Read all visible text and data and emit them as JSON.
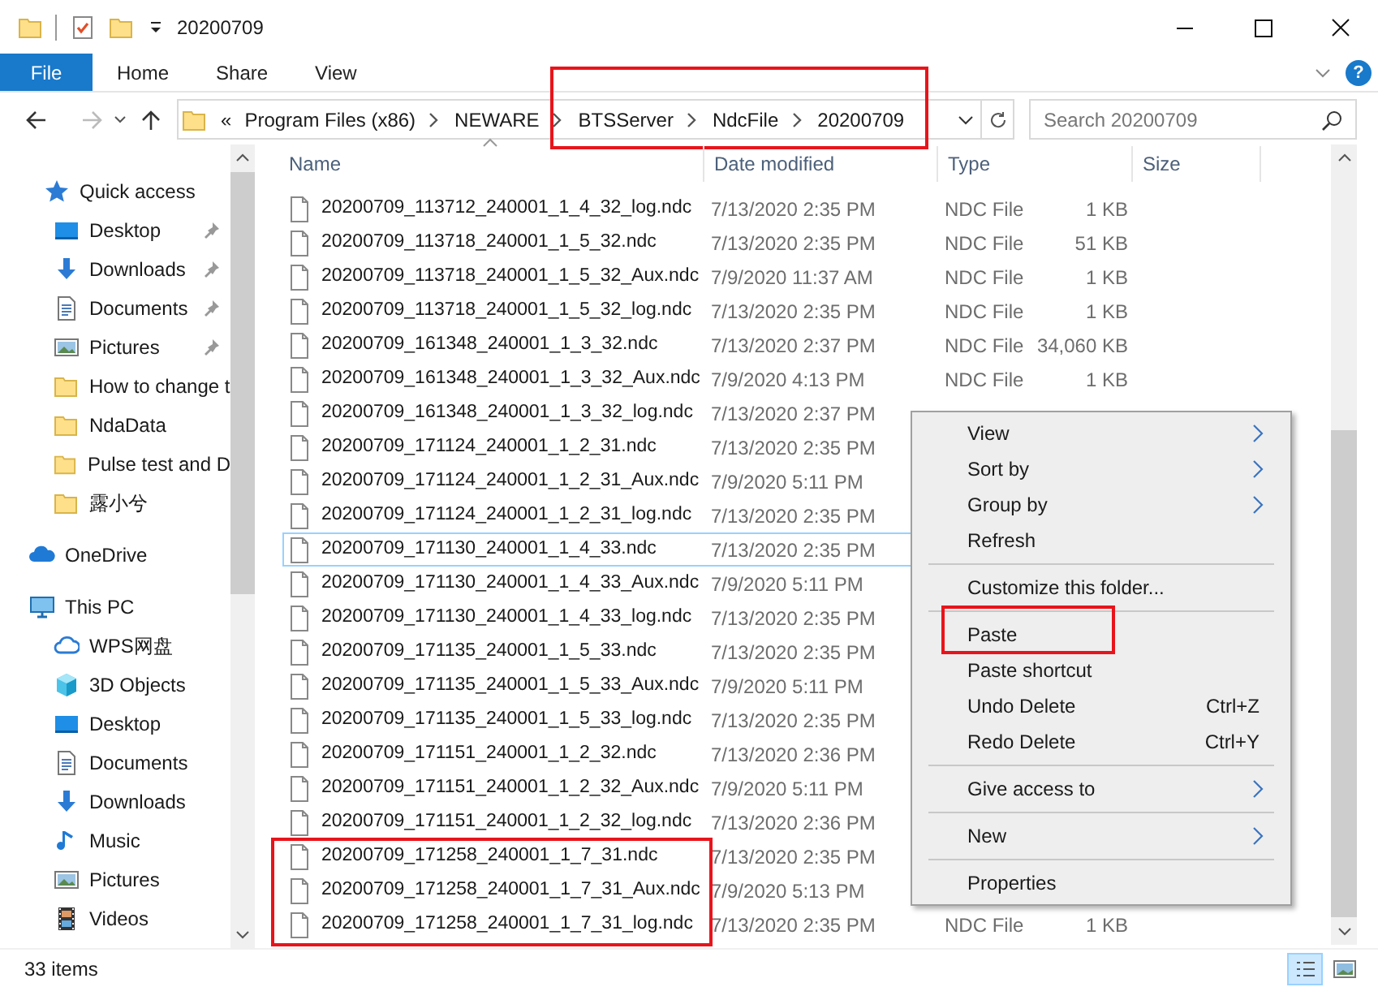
{
  "window": {
    "title": "20200709"
  },
  "ribbon": {
    "tabs": [
      {
        "label": "File",
        "selected": true
      },
      {
        "label": "Home",
        "selected": false
      },
      {
        "label": "Share",
        "selected": false
      },
      {
        "label": "View",
        "selected": false
      }
    ],
    "help": "?"
  },
  "address": {
    "overflow": "«",
    "crumbs": [
      {
        "label": "Program Files (x86)",
        "highlighted": false
      },
      {
        "label": "NEWARE",
        "highlighted": false
      },
      {
        "label": "BTSServer",
        "highlighted": true
      },
      {
        "label": "NdcFile",
        "highlighted": true
      },
      {
        "label": "20200709",
        "highlighted": true
      }
    ]
  },
  "search": {
    "placeholder": "Search 20200709"
  },
  "nav": [
    {
      "label": "Quick access",
      "kind": "star",
      "children": [
        {
          "label": "Desktop",
          "kind": "desktop",
          "pinned": true
        },
        {
          "label": "Downloads",
          "kind": "download",
          "pinned": true
        },
        {
          "label": "Documents",
          "kind": "document",
          "pinned": true
        },
        {
          "label": "Pictures",
          "kind": "picture",
          "pinned": true
        },
        {
          "label": "How to change t",
          "kind": "folder",
          "pinned": false
        },
        {
          "label": "NdaData",
          "kind": "folder",
          "pinned": false
        },
        {
          "label": "Pulse test and D",
          "kind": "folder",
          "pinned": false
        },
        {
          "label": "露小兮",
          "kind": "folder",
          "pinned": false
        }
      ]
    },
    {
      "label": "OneDrive",
      "kind": "onedrive"
    },
    {
      "label": "This PC",
      "kind": "pc",
      "children": [
        {
          "label": "WPS网盘",
          "kind": "cloud",
          "pinned": false
        },
        {
          "label": "3D Objects",
          "kind": "cube",
          "pinned": false
        },
        {
          "label": "Desktop",
          "kind": "desktop",
          "pinned": false
        },
        {
          "label": "Documents",
          "kind": "document",
          "pinned": false
        },
        {
          "label": "Downloads",
          "kind": "download",
          "pinned": false
        },
        {
          "label": "Music",
          "kind": "music",
          "pinned": false
        },
        {
          "label": "Pictures",
          "kind": "picture",
          "pinned": false
        },
        {
          "label": "Videos",
          "kind": "video",
          "pinned": false
        }
      ]
    }
  ],
  "table": {
    "columns": [
      "Name",
      "Date modified",
      "Type",
      "Size"
    ],
    "rows": [
      {
        "name": "20200709_113712_240001_1_4_32_log.ndc",
        "date": "7/13/2020 2:35 PM",
        "type": "NDC File",
        "size": "1 KB",
        "focused": false,
        "highlighted": false
      },
      {
        "name": "20200709_113718_240001_1_5_32.ndc",
        "date": "7/13/2020 2:35 PM",
        "type": "NDC File",
        "size": "51 KB",
        "focused": false,
        "highlighted": false
      },
      {
        "name": "20200709_113718_240001_1_5_32_Aux.ndc",
        "date": "7/9/2020 11:37 AM",
        "type": "NDC File",
        "size": "1 KB",
        "focused": false,
        "highlighted": false
      },
      {
        "name": "20200709_113718_240001_1_5_32_log.ndc",
        "date": "7/13/2020 2:35 PM",
        "type": "NDC File",
        "size": "1 KB",
        "focused": false,
        "highlighted": false
      },
      {
        "name": "20200709_161348_240001_1_3_32.ndc",
        "date": "7/13/2020 2:37 PM",
        "type": "NDC File",
        "size": "34,060 KB",
        "focused": false,
        "highlighted": false
      },
      {
        "name": "20200709_161348_240001_1_3_32_Aux.ndc",
        "date": "7/9/2020 4:13 PM",
        "type": "NDC File",
        "size": "1 KB",
        "focused": false,
        "highlighted": false
      },
      {
        "name": "20200709_161348_240001_1_3_32_log.ndc",
        "date": "7/13/2020 2:37 PM",
        "focused": false,
        "highlighted": false
      },
      {
        "name": "20200709_171124_240001_1_2_31.ndc",
        "date": "7/13/2020 2:35 PM",
        "focused": false,
        "highlighted": false
      },
      {
        "name": "20200709_171124_240001_1_2_31_Aux.ndc",
        "date": "7/9/2020 5:11 PM",
        "focused": false,
        "highlighted": false
      },
      {
        "name": "20200709_171124_240001_1_2_31_log.ndc",
        "date": "7/13/2020 2:35 PM",
        "focused": false,
        "highlighted": false
      },
      {
        "name": "20200709_171130_240001_1_4_33.ndc",
        "date": "7/13/2020 2:35 PM",
        "focused": true,
        "highlighted": false
      },
      {
        "name": "20200709_171130_240001_1_4_33_Aux.ndc",
        "date": "7/9/2020 5:11 PM",
        "focused": false,
        "highlighted": false
      },
      {
        "name": "20200709_171130_240001_1_4_33_log.ndc",
        "date": "7/13/2020 2:35 PM",
        "focused": false,
        "highlighted": false
      },
      {
        "name": "20200709_171135_240001_1_5_33.ndc",
        "date": "7/13/2020 2:35 PM",
        "focused": false,
        "highlighted": false
      },
      {
        "name": "20200709_171135_240001_1_5_33_Aux.ndc",
        "date": "7/9/2020 5:11 PM",
        "focused": false,
        "highlighted": false
      },
      {
        "name": "20200709_171135_240001_1_5_33_log.ndc",
        "date": "7/13/2020 2:35 PM",
        "focused": false,
        "highlighted": false
      },
      {
        "name": "20200709_171151_240001_1_2_32.ndc",
        "date": "7/13/2020 2:36 PM",
        "focused": false,
        "highlighted": false
      },
      {
        "name": "20200709_171151_240001_1_2_32_Aux.ndc",
        "date": "7/9/2020 5:11 PM",
        "focused": false,
        "highlighted": false
      },
      {
        "name": "20200709_171151_240001_1_2_32_log.ndc",
        "date": "7/13/2020 2:36 PM",
        "focused": false,
        "highlighted": false
      },
      {
        "name": "20200709_171258_240001_1_7_31.ndc",
        "date": "7/13/2020 2:35 PM",
        "focused": false,
        "highlighted": true
      },
      {
        "name": "20200709_171258_240001_1_7_31_Aux.ndc",
        "date": "7/9/2020 5:13 PM",
        "focused": false,
        "highlighted": true
      },
      {
        "name": "20200709_171258_240001_1_7_31_log.ndc",
        "date": "7/13/2020 2:35 PM",
        "type": "NDC File",
        "size": "1 KB",
        "focused": false,
        "highlighted": true
      }
    ]
  },
  "context_menu": {
    "items": [
      {
        "kind": "item",
        "label": "View",
        "submenu": true,
        "highlighted": false
      },
      {
        "kind": "item",
        "label": "Sort by",
        "submenu": true,
        "highlighted": false
      },
      {
        "kind": "item",
        "label": "Group by",
        "submenu": true,
        "highlighted": false
      },
      {
        "kind": "item",
        "label": "Refresh",
        "submenu": false,
        "highlighted": false
      },
      {
        "kind": "separator"
      },
      {
        "kind": "item",
        "label": "Customize this folder...",
        "submenu": false,
        "highlighted": false
      },
      {
        "kind": "separator"
      },
      {
        "kind": "item",
        "label": "Paste",
        "submenu": false,
        "highlighted": true
      },
      {
        "kind": "item",
        "label": "Paste shortcut",
        "submenu": false,
        "highlighted": false
      },
      {
        "kind": "item",
        "label": "Undo Delete",
        "shortcut": "Ctrl+Z",
        "submenu": false,
        "highlighted": false
      },
      {
        "kind": "item",
        "label": "Redo Delete",
        "shortcut": "Ctrl+Y",
        "submenu": false,
        "highlighted": false
      },
      {
        "kind": "separator"
      },
      {
        "kind": "item",
        "label": "Give access to",
        "submenu": true,
        "highlighted": false
      },
      {
        "kind": "separator"
      },
      {
        "kind": "item",
        "label": "New",
        "submenu": true,
        "highlighted": false
      },
      {
        "kind": "separator"
      },
      {
        "kind": "item",
        "label": "Properties",
        "submenu": false,
        "highlighted": false
      }
    ]
  },
  "status_bar": {
    "count": "33 items",
    "views": [
      {
        "kind": "details",
        "selected": true
      },
      {
        "kind": "large_icons",
        "selected": false
      }
    ]
  }
}
